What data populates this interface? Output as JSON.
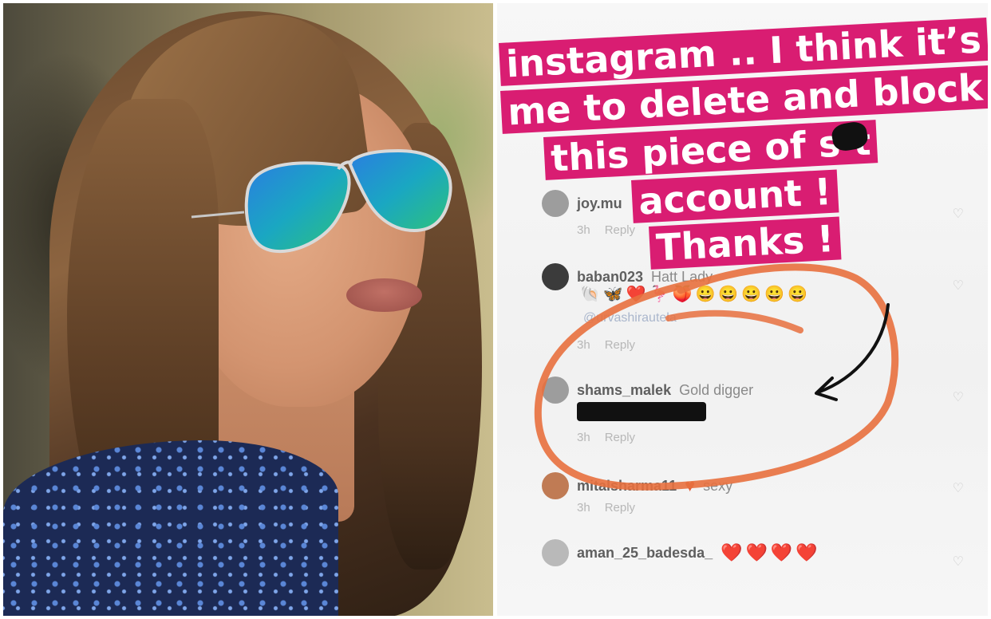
{
  "story": {
    "caption_lines": [
      "instagram .. I think it’s",
      "me to delete and block",
      "this piece of s   t",
      "account !",
      "Thanks !"
    ],
    "comments": [
      {
        "username": "joy.mu",
        "text": "",
        "reply": "Reply",
        "time": "3h"
      },
      {
        "username": "baban023",
        "text": "Hatt Lady",
        "emojis": "🐚🦋❤️🦩🍑😀😀😀😀😀",
        "mention": "@urvashirautela",
        "reply": "Reply",
        "time": "3h"
      },
      {
        "username": "shams_malek",
        "text": "Gold digger",
        "reply": "Reply",
        "time": "3h"
      },
      {
        "username": "mitalsharma11",
        "text": "sexy",
        "reply": "Reply",
        "time": "3h"
      },
      {
        "username": "aman_25_badesda_",
        "text": "❤️❤️❤️❤️",
        "reply": "",
        "time": ""
      }
    ],
    "highlight_color": "#e8703e",
    "caption_color": "#d91d72"
  }
}
